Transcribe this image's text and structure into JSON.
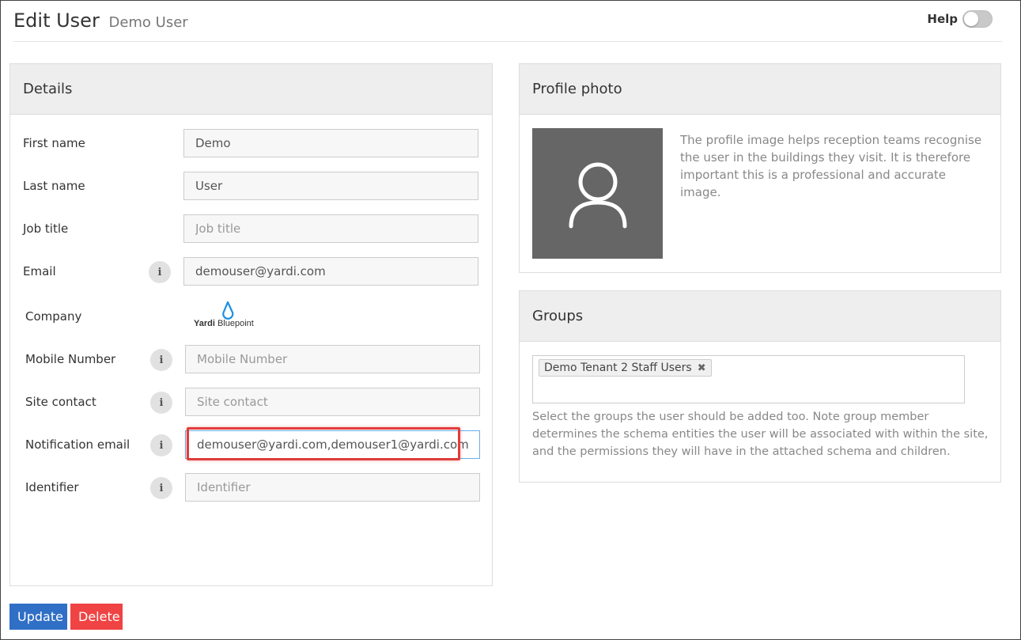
{
  "header": {
    "title": "Edit User",
    "subtitle": "Demo User",
    "help_label": "Help"
  },
  "details": {
    "heading": "Details",
    "fields": [
      {
        "label": "First name",
        "value": "Demo",
        "placeholder": "First name"
      },
      {
        "label": "Last name",
        "value": "User",
        "placeholder": "Last name"
      },
      {
        "label": "Job title",
        "value": "",
        "placeholder": "Job title"
      },
      {
        "label": "Email",
        "value": "demouser@yardi.com",
        "placeholder": "Email"
      },
      {
        "label": "Company"
      },
      {
        "label": "Mobile Number",
        "value": "",
        "placeholder": "Mobile Number"
      },
      {
        "label": "Site contact",
        "value": "",
        "placeholder": "Site contact"
      },
      {
        "label": "Notification email",
        "value": "demouser@yardi.com,demouser1@yardi.com",
        "placeholder": ""
      },
      {
        "label": "Identifier",
        "value": "",
        "placeholder": "Identifier"
      }
    ],
    "company_logo": {
      "brand": "Yardi",
      "product": "Bluepoint"
    }
  },
  "profile": {
    "heading": "Profile photo",
    "description": "The profile image helps reception teams recognise the user in the buildings they visit. It is therefore important this is a professional and accurate image."
  },
  "groups": {
    "heading": "Groups",
    "tags": [
      "Demo Tenant 2 Staff Users"
    ],
    "description": "Select the groups the user should be added too. Note group member determines the schema entities the user will be associated with within the site, and the permissions they will have in the attached schema and children."
  },
  "actions": {
    "update_label": "Update",
    "delete_label": "Delete"
  },
  "icons": {
    "info": "info-icon",
    "avatar": "user-avatar-icon",
    "remove": "remove-tag-icon"
  },
  "colors": {
    "primary": "#2f6fc6",
    "danger": "#f04343",
    "highlight": "#e03c3c",
    "logo_blue": "#1a8fe3"
  }
}
